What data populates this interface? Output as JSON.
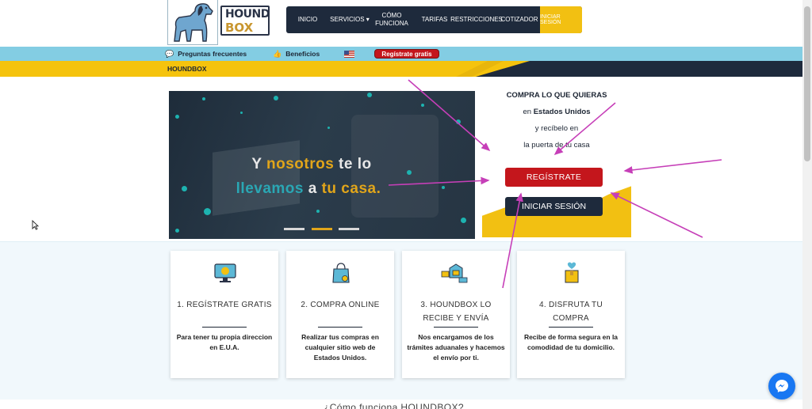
{
  "brand": {
    "logo_line1": "HOUND",
    "logo_line2": "BOX"
  },
  "nav": {
    "items": [
      {
        "label": "INICIO"
      },
      {
        "label": "SERVICIOS ▾"
      },
      {
        "label": "CÓMO FUNCIONA"
      },
      {
        "label": "TARIFAS"
      },
      {
        "label": "RESTRICCIONES"
      },
      {
        "label": "COTIZADOR"
      }
    ],
    "login_label": "INICIAR SESIÓN"
  },
  "topbar": {
    "faq": "Preguntas frecuentes",
    "benefits": "Beneficios",
    "register": "Regístrate gratis"
  },
  "section_label": "HOUNDBOX",
  "hero": {
    "line1_a": "Y ",
    "line1_b": "nosotros",
    "line1_c": " te lo",
    "line2_a": "llevamos",
    "line2_b": " a ",
    "line2_c": "tu casa."
  },
  "side": {
    "line1": "COMPRA LO QUE QUIERAS",
    "line2_a": "en ",
    "line2_b": "Estados Unidos",
    "line3": "y recíbelo en",
    "line4": "la puerta de tu casa",
    "register_button": "REGÍSTRATE",
    "login_button": "INICIAR SESIÓN"
  },
  "steps": [
    {
      "title": "1. REGÍSTRATE GRATIS",
      "desc": "Para tener tu propia direccion en E.U.A.",
      "icon": "monitor-icon"
    },
    {
      "title": "2. COMPRA ONLINE",
      "desc": "Realizar tus compras en cualquier sitio web de Estados Unidos.",
      "icon": "shopping-bag-icon"
    },
    {
      "title": "3. HOUNDBOX LO RECIBE Y ENVÍA",
      "desc": "Nos encargamos de los trámites aduanales y hacemos el envío por ti.",
      "icon": "shipping-icon"
    },
    {
      "title": "4. DISFRUTA TU COMPRA",
      "desc": "Recibe de forma segura en la comodidad de tu domicilio.",
      "icon": "package-heart-icon"
    }
  ],
  "bottom_title": "¿Cómo funciona HOUNDBOX?",
  "colors": {
    "navy": "#1e2a3c",
    "yellow": "#f5c30d",
    "red": "#c4161c",
    "lightblue": "#83cde3",
    "annotation": "#c63fb8"
  }
}
